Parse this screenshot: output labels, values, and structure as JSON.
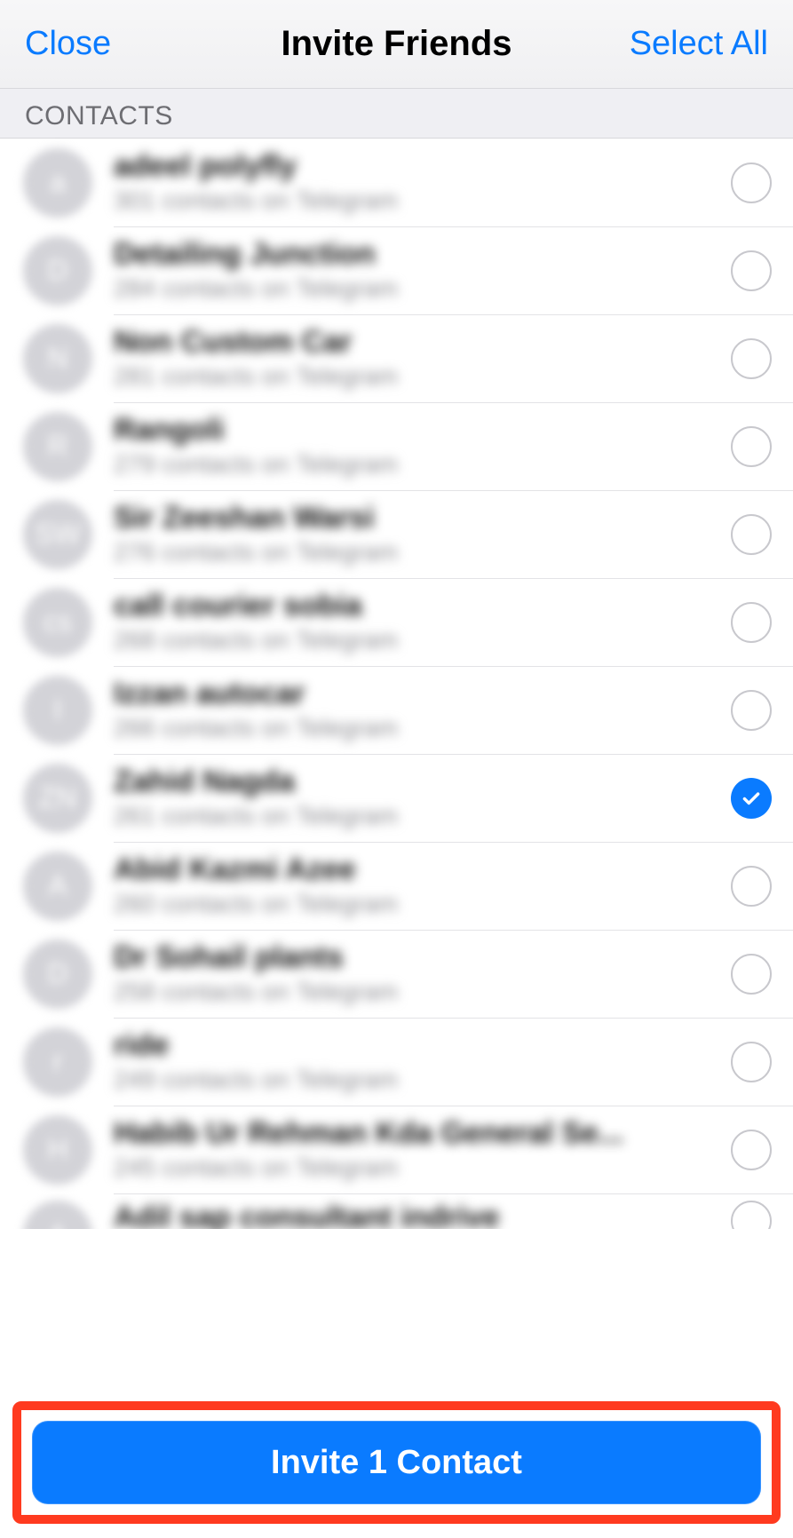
{
  "header": {
    "close": "Close",
    "title": "Invite Friends",
    "select_all": "Select All"
  },
  "section_label": "CONTACTS",
  "contacts": [
    {
      "initial": "a",
      "name": "adeel polyfly",
      "sub": "301 contacts on Telegram",
      "selected": false
    },
    {
      "initial": "D",
      "name": "Detailing Junction",
      "sub": "284 contacts on Telegram",
      "selected": false
    },
    {
      "initial": "N",
      "name": "Non Custom Car",
      "sub": "281 contacts on Telegram",
      "selected": false
    },
    {
      "initial": "R",
      "name": "Rangoli",
      "sub": "279 contacts on Telegram",
      "selected": false
    },
    {
      "initial": "SW",
      "name": "Sir Zeeshan Warsi",
      "sub": "276 contacts on Telegram",
      "selected": false
    },
    {
      "initial": "cs",
      "name": "call courier sobia",
      "sub": "268 contacts on Telegram",
      "selected": false
    },
    {
      "initial": "I",
      "name": "Izzan autocar",
      "sub": "266 contacts on Telegram",
      "selected": false
    },
    {
      "initial": "ZN",
      "name": "Zahid Nagda",
      "sub": "261 contacts on Telegram",
      "selected": true
    },
    {
      "initial": "A",
      "name": "Abid Kazmi Azee",
      "sub": "260 contacts on Telegram",
      "selected": false
    },
    {
      "initial": "D",
      "name": "Dr Sohail plants",
      "sub": "258 contacts on Telegram",
      "selected": false
    },
    {
      "initial": "r",
      "name": "ride",
      "sub": "249 contacts on Telegram",
      "selected": false
    },
    {
      "initial": "H",
      "name": "Habib Ur Rehman Kda General Se...",
      "sub": "245 contacts on Telegram",
      "selected": false
    },
    {
      "initial": "A",
      "name": "Adil sap consultant indrive",
      "sub": "",
      "selected": false
    }
  ],
  "invite_button": "Invite 1 Contact"
}
